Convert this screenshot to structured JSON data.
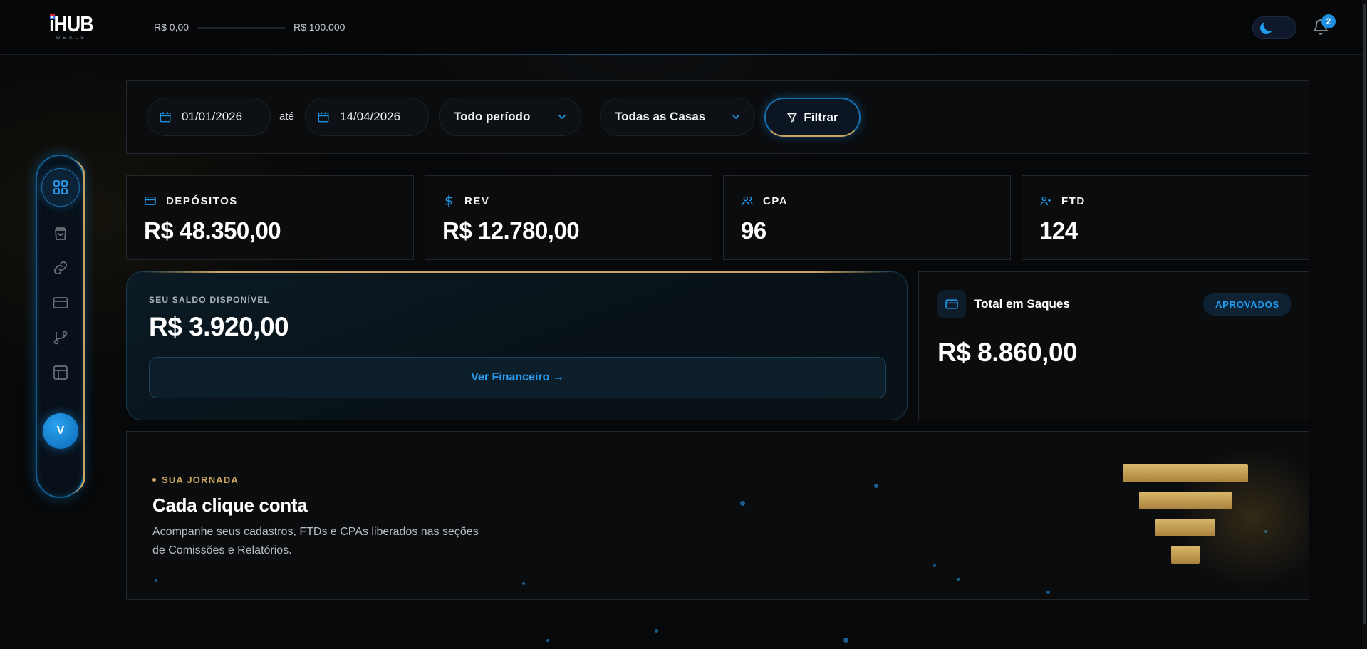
{
  "header": {
    "logo_text": "iHUB",
    "logo_sub": "DEALS",
    "range_min": "R$ 0,00",
    "range_max": "R$ 100.000",
    "notifications_count": "2",
    "theme_icon": "moon-icon"
  },
  "sidebar": {
    "items": [
      {
        "icon": "dashboard-grid-icon"
      },
      {
        "icon": "shopping-bag-icon"
      },
      {
        "icon": "link-icon"
      },
      {
        "icon": "credit-card-icon"
      },
      {
        "icon": "git-branch-icon"
      },
      {
        "icon": "layout-icon"
      }
    ],
    "avatar_initial": "V"
  },
  "filters": {
    "date_from": "01/01/2026",
    "separator": "até",
    "date_to": "14/04/2026",
    "period": "Todo período",
    "houses": "Todas as Casas",
    "filter_button": "Filtrar"
  },
  "stats": [
    {
      "label": "DEPÓSITOS",
      "value": "R$ 48.350,00",
      "icon": "credit-card-icon"
    },
    {
      "label": "REV",
      "value": "R$ 12.780,00",
      "icon": "dollar-icon"
    },
    {
      "label": "CPA",
      "value": "96",
      "icon": "users-icon"
    },
    {
      "label": "FTD",
      "value": "124",
      "icon": "user-plus-icon"
    }
  ],
  "balance": {
    "label": "SEU SALDO DISPONÍVEL",
    "value": "R$ 3.920,00",
    "button": "Ver Financeiro →"
  },
  "withdrawals": {
    "title": "Total em Saques",
    "badge": "APROVADOS",
    "value": "R$ 8.860,00"
  },
  "journey": {
    "eyebrow": "SUA JORNADA",
    "title": "Cada clique conta",
    "description": "Acompanhe seus cadastros, FTDs e CPAs liberados nas seções de Comissões e Relatórios."
  },
  "colors": {
    "accent_blue": "#1f9cf0",
    "accent_gold": "#c9a460",
    "background": "#070809"
  }
}
